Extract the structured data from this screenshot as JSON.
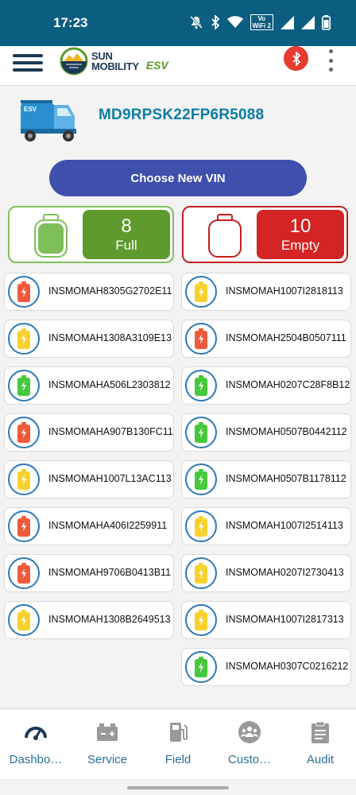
{
  "status_bar": {
    "time": "17:23",
    "icons": [
      "mute-icon",
      "bluetooth-icon",
      "wifi-icon",
      "volte-wifi-icon",
      "signal-icon",
      "signal-icon",
      "battery-icon"
    ],
    "volte_line1": "Vo",
    "volte_line2": "WiFi 2"
  },
  "app_bar": {
    "logo_line1": "SUN",
    "logo_line2": "MOBILITY",
    "logo_suffix": "ESV",
    "bluetooth_color": "#e63b2e"
  },
  "vehicle": {
    "badge": "ESV",
    "vin": "MD9RPSK22FP6R5088"
  },
  "choose_button": "Choose New VIN",
  "summary": {
    "full": {
      "count": "8",
      "label": "Full",
      "color": "#5f9a2e"
    },
    "empty": {
      "count": "10",
      "label": "Empty",
      "color": "#d42424"
    }
  },
  "battery_colors": {
    "red": "#ee5a3a",
    "yellow": "#f7d22e",
    "green": "#46c83c"
  },
  "batteries_left": [
    {
      "id": "INSMOMAH8305G2702E11",
      "status": "red"
    },
    {
      "id": "INSMOMAH1308A3109E13",
      "status": "yellow"
    },
    {
      "id": "INSMOMAHA506L2303812",
      "status": "green"
    },
    {
      "id": "INSMOMAHA907B130FC11",
      "status": "red"
    },
    {
      "id": "INSMOMAH1007L13AC113",
      "status": "yellow"
    },
    {
      "id": "INSMOMAHA406I2259911",
      "status": "red"
    },
    {
      "id": "INSMOMAH9706B0413B11",
      "status": "red"
    },
    {
      "id": "INSMOMAH1308B2649513",
      "status": "yellow"
    }
  ],
  "batteries_right": [
    {
      "id": "INSMOMAH1007I2818113",
      "status": "yellow"
    },
    {
      "id": "INSMOMAH2504B0507111",
      "status": "red"
    },
    {
      "id": "INSMOMAH0207C28F8B12",
      "status": "green"
    },
    {
      "id": "INSMOMAH0507B0442112",
      "status": "green"
    },
    {
      "id": "INSMOMAH0507B1178112",
      "status": "green"
    },
    {
      "id": "INSMOMAH1007I2514113",
      "status": "yellow"
    },
    {
      "id": "INSMOMAH0207I2730413",
      "status": "yellow"
    },
    {
      "id": "INSMOMAH1007I2817313",
      "status": "yellow"
    },
    {
      "id": "INSMOMAH0307C0216212",
      "status": "green"
    }
  ],
  "bottom_nav": [
    {
      "label": "Dashbo…",
      "icon": "speedometer-icon"
    },
    {
      "label": "Service",
      "icon": "battery-service-icon"
    },
    {
      "label": "Field",
      "icon": "fuel-station-icon"
    },
    {
      "label": "Custo…",
      "icon": "customers-icon"
    },
    {
      "label": "Audit",
      "icon": "clipboard-icon"
    }
  ]
}
